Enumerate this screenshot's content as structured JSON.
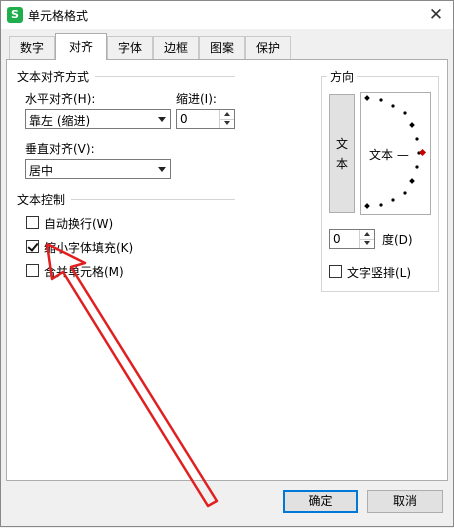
{
  "window": {
    "title": "单元格格式",
    "app_icon": "S",
    "close_glyph": "✕"
  },
  "tabs": [
    "数字",
    "对齐",
    "字体",
    "边框",
    "图案",
    "保护"
  ],
  "active_tab": "对齐",
  "alignment": {
    "section_title": "文本对齐方式",
    "horizontal": {
      "label": "水平对齐(H):",
      "value": "靠左 (缩进)"
    },
    "indent": {
      "label": "缩进(I):",
      "value": "0"
    },
    "vertical": {
      "label": "垂直对齐(V):",
      "value": "居中"
    }
  },
  "text_control": {
    "section_title": "文本控制",
    "wrap": {
      "label": "自动换行(W)",
      "checked": false
    },
    "shrink": {
      "label": "缩小字体填充(K)",
      "checked": true
    },
    "merge": {
      "label": "合并单元格(M)",
      "checked": false
    }
  },
  "orientation": {
    "section_title": "方向",
    "vertical_text": [
      "文",
      "本"
    ],
    "dial_label": "文本 —",
    "degree_value": "0",
    "degree_label": "度(D)",
    "vertical_stack": {
      "label": "文字竖排(L)",
      "checked": false
    }
  },
  "buttons": {
    "ok": "确定",
    "cancel": "取消"
  },
  "annotation": {
    "color": "#e02020"
  }
}
